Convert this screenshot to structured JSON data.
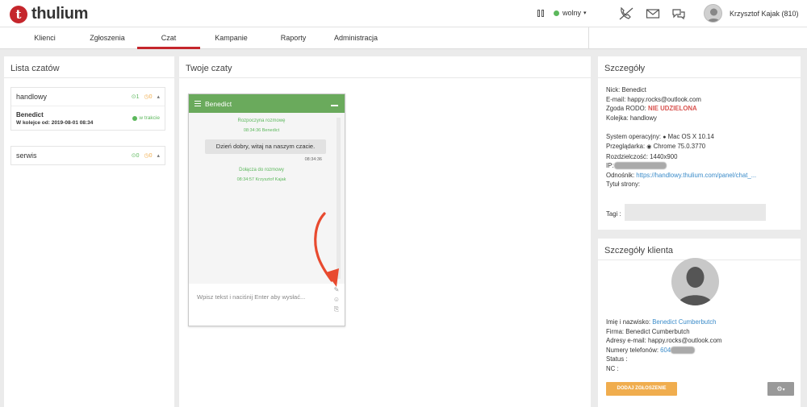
{
  "header": {
    "logo_letter": "t",
    "logo_text": "thulium",
    "status_label": "wolny",
    "user_name": "Krzysztof Kajak (810)"
  },
  "nav": {
    "items": [
      {
        "label": "Klienci"
      },
      {
        "label": "Zgłoszenia"
      },
      {
        "label": "Czat"
      },
      {
        "label": "Kampanie"
      },
      {
        "label": "Raporty"
      },
      {
        "label": "Administracja"
      }
    ],
    "active": "Czat"
  },
  "chat_list": {
    "title": "Lista czatów",
    "groups": [
      {
        "name": "handlowy",
        "active_count": "1",
        "waiting_count": "0"
      },
      {
        "name": "serwis",
        "active_count": "0",
        "waiting_count": "0"
      }
    ],
    "item": {
      "name": "Benedict",
      "queue_label": "W kolejce od: 2019-08-01 08:34",
      "status": "w trakcie"
    }
  },
  "my_chats": {
    "title": "Twoje czaty",
    "window": {
      "name": "Benedict",
      "started": "Rozpoczyna rozmowę",
      "started_time": "08:34:36  Benedict",
      "message": "Dzień dobry, witaj na naszym czacie.",
      "message_time": "08:34:36",
      "joined": "Dołącza do rozmowy",
      "joined_time": "08:34:57  Krzysztof Kajak",
      "input_placeholder": "Wpisz tekst i naciśnij Enter aby wysłać..."
    }
  },
  "details": {
    "title": "Szczegóły",
    "nick": "Nick: Benedict",
    "email": "E-mail: happy.rocks@outlook.com",
    "rodo_label": "Zgoda RODO: ",
    "rodo_value": "NIE UDZIELONA",
    "queue": "Kolejka: handlowy",
    "os_label": "System operacyjny: ",
    "os_value": "Mac OS X 10.14",
    "browser_label": "Przeglądarka: ",
    "browser_value": "Chrome 75.0.3770",
    "resolution": "Rozdzielczość: 1440x900",
    "ip_label": "IP:",
    "referrer_label": "Odnośnik: ",
    "referrer_value": "https://handlowy.thulium.com/panel/chat_...",
    "page_title": "Tytuł strony:",
    "tags_label": "Tagi :"
  },
  "client": {
    "title": "Szczegóły klienta",
    "name_label": "Imię i nazwisko: ",
    "name_value": "Benedict Cumberbutch",
    "company": "Firma: Benedict Cumberbutch",
    "emails": "Adresy e-mail: happy.rocks@outlook.com",
    "phones_label": "Numery telefonów: ",
    "phones_value": "604",
    "status": "Status :",
    "nc": "NC :",
    "add_ticket_button": "DODAJ ZGŁOSZENIE"
  },
  "colors": {
    "brand_red": "#c5262c",
    "chat_green": "#6aaa5c",
    "orange": "#f0ad4e",
    "link_blue": "#3a8bc9"
  }
}
